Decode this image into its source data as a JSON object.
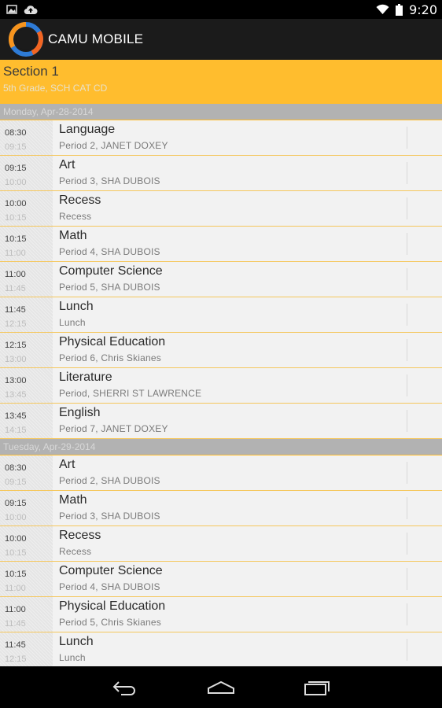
{
  "status_bar": {
    "time": "9:20",
    "left_icons": [
      "image-icon",
      "cloud-upload-icon"
    ],
    "right_icons": [
      "wifi-icon",
      "battery-icon"
    ]
  },
  "app": {
    "title": "CAMU MOBILE",
    "logo_colors": [
      "#f7941d",
      "#2e7bd6"
    ]
  },
  "section": {
    "title": "Section 1",
    "subtitle": "5th Grade, SCH CAT CD",
    "color": "#ffbd2e"
  },
  "days": [
    {
      "label": "Monday, Apr-28-2014",
      "periods": [
        {
          "start": "08:30",
          "end": "09:15",
          "subject": "Language",
          "detail": "Period 2, JANET DOXEY"
        },
        {
          "start": "09:15",
          "end": "10:00",
          "subject": "Art",
          "detail": "Period 3, SHA DUBOIS"
        },
        {
          "start": "10:00",
          "end": "10:15",
          "subject": "Recess",
          "detail": "Recess"
        },
        {
          "start": "10:15",
          "end": "11:00",
          "subject": "Math",
          "detail": "Period 4, SHA DUBOIS"
        },
        {
          "start": "11:00",
          "end": "11:45",
          "subject": "Computer Science",
          "detail": "Period 5, SHA DUBOIS"
        },
        {
          "start": "11:45",
          "end": "12:15",
          "subject": "Lunch",
          "detail": "Lunch"
        },
        {
          "start": "12:15",
          "end": "13:00",
          "subject": "Physical Education",
          "detail": "Period 6, Chris Skianes"
        },
        {
          "start": "13:00",
          "end": "13:45",
          "subject": "Literature",
          "detail": "Period, SHERRI ST LAWRENCE"
        },
        {
          "start": "13:45",
          "end": "14:15",
          "subject": "English",
          "detail": "Period 7, JANET DOXEY"
        }
      ]
    },
    {
      "label": "Tuesday, Apr-29-2014",
      "periods": [
        {
          "start": "08:30",
          "end": "09:15",
          "subject": "Art",
          "detail": "Period 2, SHA DUBOIS"
        },
        {
          "start": "09:15",
          "end": "10:00",
          "subject": "Math",
          "detail": "Period 3, SHA DUBOIS"
        },
        {
          "start": "10:00",
          "end": "10:15",
          "subject": "Recess",
          "detail": "Recess"
        },
        {
          "start": "10:15",
          "end": "11:00",
          "subject": "Computer Science",
          "detail": "Period 4, SHA DUBOIS"
        },
        {
          "start": "11:00",
          "end": "11:45",
          "subject": "Physical Education",
          "detail": "Period 5, Chris Skianes"
        },
        {
          "start": "11:45",
          "end": "12:15",
          "subject": "Lunch",
          "detail": "Lunch"
        }
      ]
    }
  ],
  "nav_bar": {
    "buttons": [
      "back-icon",
      "home-icon",
      "recent-apps-icon"
    ]
  }
}
